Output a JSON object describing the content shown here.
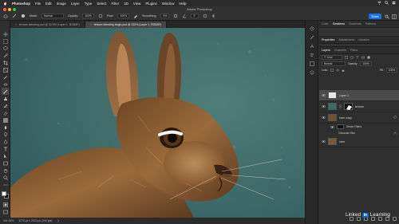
{
  "menubar": {
    "app": "Photoshop",
    "items": [
      "File",
      "Edit",
      "Image",
      "Layer",
      "Type",
      "Select",
      "Filter",
      "3D",
      "View",
      "Plugins",
      "Window",
      "Help"
    ]
  },
  "window": {
    "title": "Adobe Photoshop"
  },
  "options": {
    "mode_label": "Mode:",
    "mode_value": "Normal",
    "opacity_label": "Opacity:",
    "opacity_value": "100%",
    "flow_label": "Flow:",
    "flow_value": "100%",
    "smoothing_label": "Smoothing:",
    "smoothing_value": "0%",
    "angle_value": "0°",
    "share_label": "Share"
  },
  "tabs": [
    {
      "label": "texture blending.psd @ 92.5% (Layer 1, RGB/8*)",
      "active": false
    },
    {
      "label": "texture blending begin.psd @ 152% (Layer 1, RGB/8*)",
      "active": true
    }
  ],
  "status": {
    "zoom": "161.64%",
    "doc": "3276 px x 2024 px (300 ppi)"
  },
  "panels": {
    "top_tabs": [
      "Color",
      "Swatches",
      "Gradients",
      "Patterns"
    ],
    "top_active": "Swatches",
    "mid_tabs": [
      "Properties",
      "Adjustments",
      "Libraries"
    ],
    "mid_active": "Properties",
    "layer_tabs": [
      "Layers",
      "Channels",
      "Paths"
    ],
    "layer_active": "Layers",
    "kind_label": "Kind",
    "blend_mode": "Normal",
    "opacity_label": "Opacity:",
    "opacity_value": "100%",
    "lock_label": "Lock:",
    "fill_label": "Fill:",
    "fill_value": "100%",
    "layers": [
      {
        "name": "Layer 1",
        "selected": true
      },
      {
        "name": "texture",
        "selected": false
      },
      {
        "name": "hare copy",
        "selected": false
      },
      {
        "name": "hare",
        "selected": false
      }
    ],
    "smart_filters_label": "Smart Filters",
    "gaussian_blur_label": "Gaussian Blur"
  },
  "watermark": {
    "brand": "Linked",
    "in": "in",
    "suffix": "Learning"
  },
  "colors": {
    "accent": "#1473e6",
    "canvas_teal": "#3e6a6a",
    "hare_brown": "#8a5a32"
  }
}
